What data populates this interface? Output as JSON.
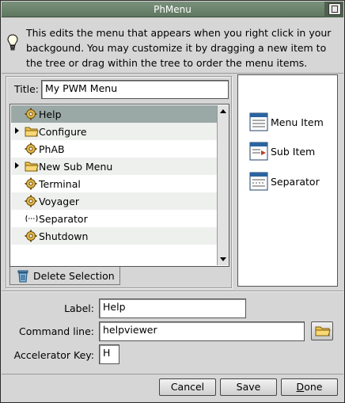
{
  "window": {
    "title": "PhMenu"
  },
  "info": {
    "text_lines": [
      "This edits the menu that appears when you right click in your",
      "backgound.  You may customize it by dragging a new item to",
      "the tree or drag within the tree to order the menu items."
    ]
  },
  "menu_title": {
    "label": "Title:",
    "value": "My PWM Menu"
  },
  "tree": {
    "items": [
      {
        "label": "Help",
        "icon": "gear-icon",
        "expandable": false,
        "selected": true
      },
      {
        "label": "Configure",
        "icon": "folder-icon",
        "expandable": true,
        "selected": false
      },
      {
        "label": "PhAB",
        "icon": "gear-icon",
        "expandable": false,
        "selected": false
      },
      {
        "label": "New Sub Menu",
        "icon": "folder-icon",
        "expandable": true,
        "selected": false
      },
      {
        "label": "Terminal",
        "icon": "gear-icon",
        "expandable": false,
        "selected": false
      },
      {
        "label": "Voyager",
        "icon": "gear-icon",
        "expandable": false,
        "selected": false
      },
      {
        "label": "Separator",
        "icon": "separator-icon",
        "expandable": false,
        "selected": false
      },
      {
        "label": "Shutdown",
        "icon": "gear-icon",
        "expandable": false,
        "selected": false
      }
    ]
  },
  "delete_button": {
    "label": "Delete Selection",
    "icon": "trash-icon"
  },
  "palette": {
    "items": [
      {
        "label": "Menu Item",
        "icon": "menu-item-icon"
      },
      {
        "label": "Sub Item",
        "icon": "sub-item-icon"
      },
      {
        "label": "Separator",
        "icon": "separator-doc-icon"
      }
    ]
  },
  "fields": {
    "label": {
      "label": "Label:",
      "value": "Help"
    },
    "command": {
      "label": "Command line:",
      "value": "helpviewer"
    },
    "accelerator": {
      "label": "Accelerator Key:",
      "value": "H"
    }
  },
  "buttons": {
    "cancel": "Cancel",
    "save": "Save",
    "done_underline": "D",
    "done_rest": "one"
  },
  "colors": {
    "titlebar": "#6b836b",
    "selection": "#9aa8a6",
    "background": "#d6d6d6"
  }
}
